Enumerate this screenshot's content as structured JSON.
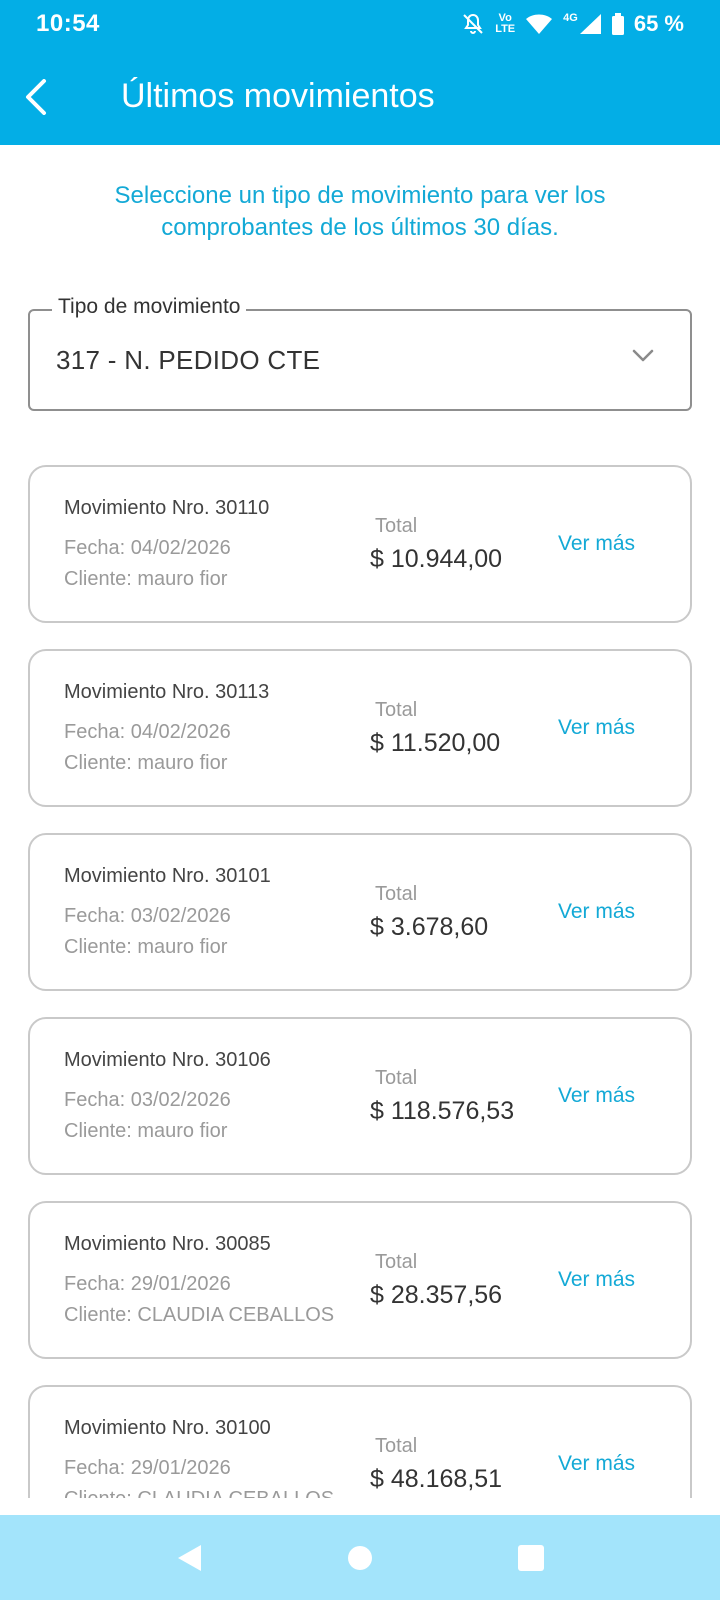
{
  "status": {
    "time": "10:54",
    "network": "4G",
    "battery": "65 %",
    "volte_top": "Vo",
    "volte_bottom": "LTE",
    "icons": [
      "bell-off-icon",
      "volte-icon",
      "wifi-icon",
      "signal-icon",
      "battery-icon"
    ]
  },
  "header": {
    "title": "Últimos movimientos",
    "back_icon": "chevron-left-icon"
  },
  "intro": {
    "line1": "Seleccione un tipo de movimiento para ver los",
    "line2": "comprobantes de los últimos 30 días."
  },
  "filter": {
    "label": "Tipo de movimiento",
    "value": "317 - N. PEDIDO CTE",
    "icon": "chevron-down-icon"
  },
  "movements": [
    {
      "number": "Movimiento Nro. 30110",
      "date": "Fecha: 04/02/2026",
      "client": "Cliente: mauro fior",
      "total_label": "Total",
      "total": "$ 10.944,00",
      "more": "Ver más"
    },
    {
      "number": "Movimiento Nro. 30113",
      "date": "Fecha: 04/02/2026",
      "client": "Cliente: mauro fior",
      "total_label": "Total",
      "total": "$ 11.520,00",
      "more": "Ver más"
    },
    {
      "number": "Movimiento Nro. 30101",
      "date": "Fecha: 03/02/2026",
      "client": "Cliente: mauro fior",
      "total_label": "Total",
      "total": "$ 3.678,60",
      "more": "Ver más"
    },
    {
      "number": "Movimiento Nro. 30106",
      "date": "Fecha: 03/02/2026",
      "client": "Cliente: mauro fior",
      "total_label": "Total",
      "total": "$ 118.576,53",
      "more": "Ver más"
    },
    {
      "number": "Movimiento Nro. 30085",
      "date": "Fecha: 29/01/2026",
      "client": "Cliente: CLAUDIA CEBALLOS",
      "total_label": "Total",
      "total": "$ 28.357,56",
      "more": "Ver más"
    },
    {
      "number": "Movimiento Nro. 30100",
      "date": "Fecha: 29/01/2026",
      "client": "Cliente: CLAUDIA CEBALLOS",
      "total_label": "Total",
      "total": "$ 48.168,51",
      "more": "Ver más"
    }
  ],
  "nav": {
    "icons": [
      "nav-back-icon",
      "nav-home-icon",
      "nav-recents-icon"
    ]
  },
  "colors": {
    "primary": "#03aee6",
    "accent_text": "#13a9d6",
    "nav_bar": "#a3e4fb"
  }
}
